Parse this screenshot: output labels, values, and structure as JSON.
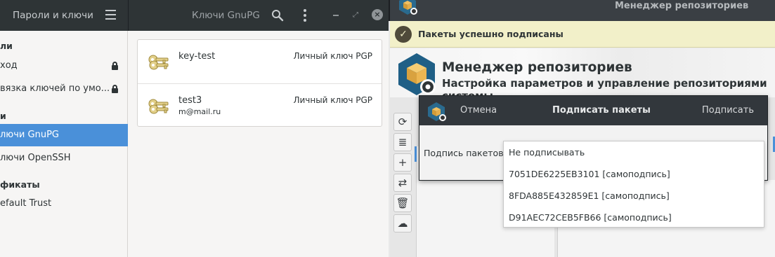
{
  "seahorse": {
    "header": {
      "left_title": "Пароли и ключи",
      "center_title": "Ключи GnuPG"
    },
    "sidebar": {
      "sections": [
        {
          "heading": "ли"
        },
        {
          "heading": "и"
        },
        {
          "heading": "фикаты"
        }
      ],
      "items": [
        {
          "label": "ход",
          "locked": true
        },
        {
          "label": "вязка ключей по умо...",
          "locked": true
        },
        {
          "label": "лючи GnuPG",
          "selected": true
        },
        {
          "label": "лючи OpenSSH"
        },
        {
          "label": "efault Trust"
        }
      ]
    },
    "keys": [
      {
        "name": "key-test",
        "email": "",
        "type": "Личный ключ PGP"
      },
      {
        "name": "test3",
        "email": "m@mail.ru",
        "type": "Личный ключ PGP"
      }
    ]
  },
  "repoman": {
    "title": "Менеджер репозиториев",
    "banner": "Пакеты успешно подписаны",
    "hero": {
      "title": "Менеджер репозиториев",
      "subtitle": "Настройка параметров и управление репозиториями системы"
    },
    "toolbar": [
      "refresh-icon",
      "database-icon",
      "plus-icon",
      "swap-icon",
      "trash-icon",
      "cloud-upload-icon"
    ],
    "accent_color": "#4a90d9"
  },
  "dialog": {
    "cancel": "Отмена",
    "title": "Подписать пакеты",
    "sign": "Подписать",
    "field_label": "Подпись пакетов:",
    "options": [
      "Не подписывать",
      "7051DE6225EB3101 [самоподпись]",
      "8FDA885E432859E1 [самоподпись]",
      "D91AEC72CEB5FB66 [самоподпись]"
    ]
  }
}
